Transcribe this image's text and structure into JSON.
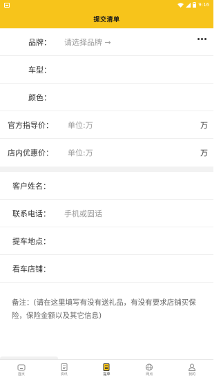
{
  "status": {
    "time": "9:16"
  },
  "header": {
    "title": "提交清单"
  },
  "form": {
    "brand_label": "品牌：",
    "brand_placeholder": "请选择品牌 →",
    "model_label": "车型：",
    "color_label": "颜色：",
    "msrp_label": "官方指导价：",
    "msrp_placeholder": "单位:万",
    "msrp_unit": "万",
    "store_price_label": "店内优惠价：",
    "store_price_placeholder": "单位:万",
    "store_price_unit": "万"
  },
  "customer": {
    "name_label": "客户姓名：",
    "phone_label": "联系电话：",
    "phone_placeholder": "手机或固话",
    "pickup_label": "提车地点：",
    "store_label": "看车店铺："
  },
  "remark": {
    "text": "备注：(请在这里填写有没有送礼品，有没有要求店铺买保险，保险金额以及其它信息)"
  },
  "tabbar": {
    "items": [
      {
        "label": "首页",
        "icon": "home-icon"
      },
      {
        "label": "资讯",
        "icon": "news-icon"
      },
      {
        "label": "提单",
        "icon": "order-icon",
        "active": true
      },
      {
        "label": "网点",
        "icon": "globe-icon"
      },
      {
        "label": "我的",
        "icon": "user-icon"
      }
    ]
  },
  "colors": {
    "accent": "#f7c41b"
  }
}
